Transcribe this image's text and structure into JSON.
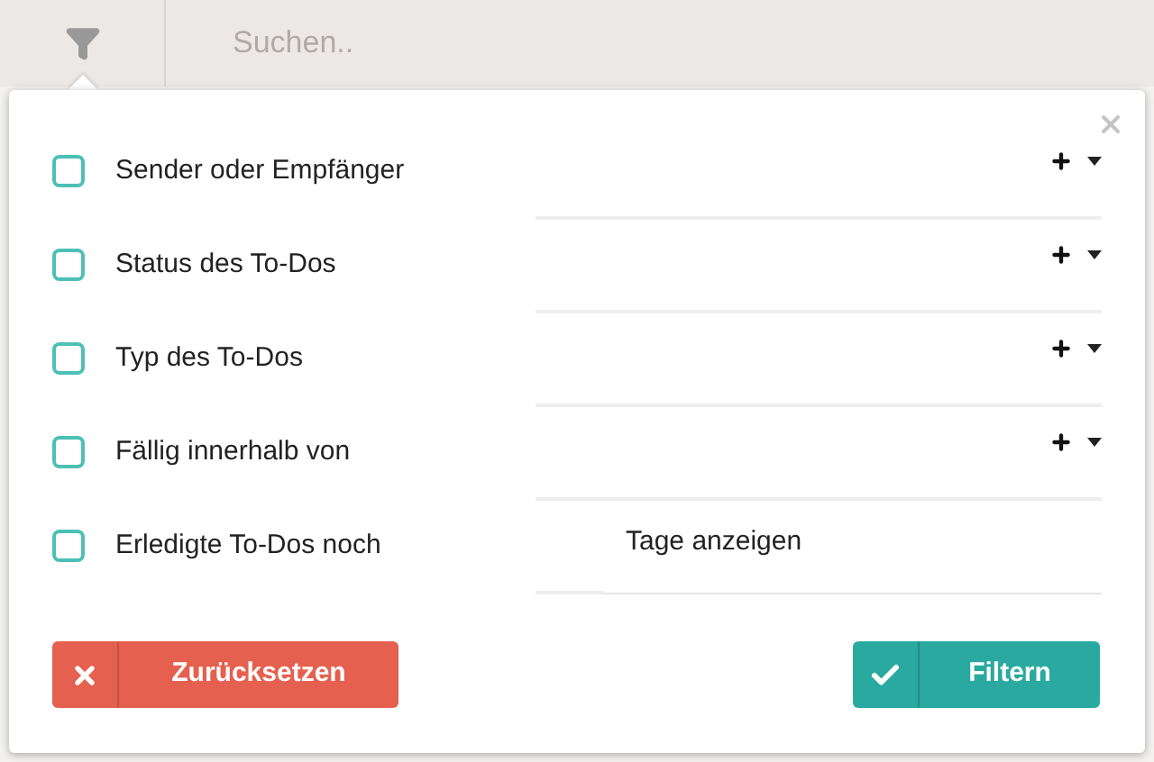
{
  "search": {
    "placeholder": "Suchen.."
  },
  "filters": [
    {
      "kind": "select",
      "label": "Sender oder Empfänger",
      "checked": false
    },
    {
      "kind": "select",
      "label": "Status des To-Dos",
      "checked": false
    },
    {
      "kind": "select",
      "label": "Typ des To-Dos",
      "checked": false
    },
    {
      "kind": "select",
      "label": "Fällig innerhalb von",
      "checked": false
    },
    {
      "kind": "days",
      "label": "Erledigte To-Dos noch",
      "checked": false,
      "suffix": "Tage anzeigen"
    }
  ],
  "buttons": [
    {
      "kind": "reset",
      "label": "Zurücksetzen"
    },
    {
      "kind": "apply",
      "label": "Filtern"
    }
  ]
}
